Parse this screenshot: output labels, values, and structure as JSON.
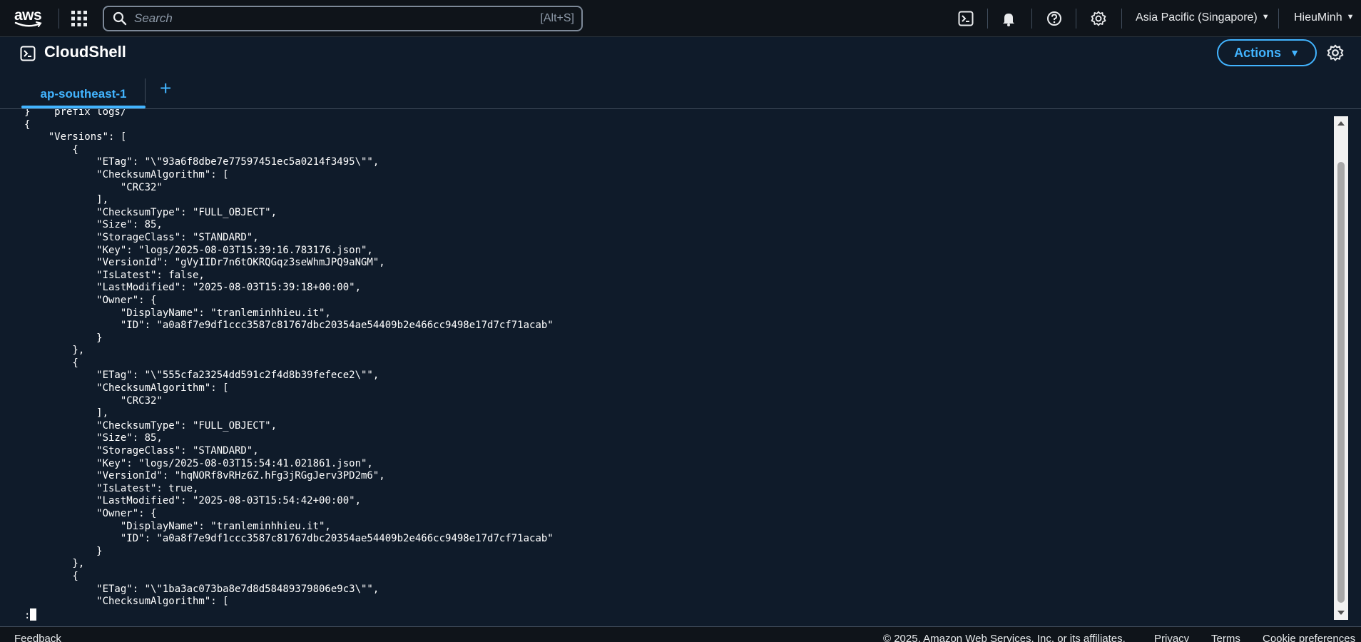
{
  "topbar": {
    "logo_text": "aws",
    "search_placeholder": "Search",
    "search_shortcut": "[Alt+S]",
    "region": "Asia Pacific (Singapore)",
    "user": "HieuMinh",
    "icons": [
      "cloudshell-icon",
      "bell-icon",
      "help-icon",
      "gear-icon"
    ]
  },
  "header": {
    "title": "CloudShell",
    "actions_label": "Actions",
    "tab_label": "ap-southeast-1",
    "add_tab_label": "+"
  },
  "terminal": {
    "lines": [
      "}    prefix logs/",
      "{",
      "    \"Versions\": [",
      "        {",
      "            \"ETag\": \"\\\"93a6f8dbe7e77597451ec5a0214f3495\\\"\",",
      "            \"ChecksumAlgorithm\": [",
      "                \"CRC32\"",
      "            ],",
      "            \"ChecksumType\": \"FULL_OBJECT\",",
      "            \"Size\": 85,",
      "            \"StorageClass\": \"STANDARD\",",
      "            \"Key\": \"logs/2025-08-03T15:39:16.783176.json\",",
      "            \"VersionId\": \"gVyIIDr7n6tOKRQGqz3seWhmJPQ9aNGM\",",
      "            \"IsLatest\": false,",
      "            \"LastModified\": \"2025-08-03T15:39:18+00:00\",",
      "            \"Owner\": {",
      "                \"DisplayName\": \"tranleminhhieu.it\",",
      "                \"ID\": \"a0a8f7e9df1ccc3587c81767dbc20354ae54409b2e466cc9498e17d7cf71acab\"",
      "            }",
      "        },",
      "        {",
      "            \"ETag\": \"\\\"555cfa23254dd591c2f4d8b39fefece2\\\"\",",
      "            \"ChecksumAlgorithm\": [",
      "                \"CRC32\"",
      "            ],",
      "            \"ChecksumType\": \"FULL_OBJECT\",",
      "            \"Size\": 85,",
      "            \"StorageClass\": \"STANDARD\",",
      "            \"Key\": \"logs/2025-08-03T15:54:41.021861.json\",",
      "            \"VersionId\": \"hqNORf8vRHz6Z.hFg3jRGgJerv3PD2m6\",",
      "            \"IsLatest\": true,",
      "            \"LastModified\": \"2025-08-03T15:54:42+00:00\",",
      "            \"Owner\": {",
      "                \"DisplayName\": \"tranleminhhieu.it\",",
      "                \"ID\": \"a0a8f7e9df1ccc3587c81767dbc20354ae54409b2e466cc9498e17d7cf71acab\"",
      "            }",
      "        },",
      "        {",
      "            \"ETag\": \"\\\"1ba3ac073ba8e7d8d58489379806e9c3\\\"\",",
      "            \"ChecksumAlgorithm\": ["
    ],
    "prompt": ":"
  },
  "footer": {
    "feedback": "Feedback",
    "copyright": "© 2025, Amazon Web Services, Inc. or its affiliates.",
    "privacy": "Privacy",
    "terms": "Terms",
    "cookies": "Cookie preferences"
  },
  "colors": {
    "accent": "#42b4ff",
    "background": "#0f1b2a",
    "topbar": "#0f141a"
  }
}
